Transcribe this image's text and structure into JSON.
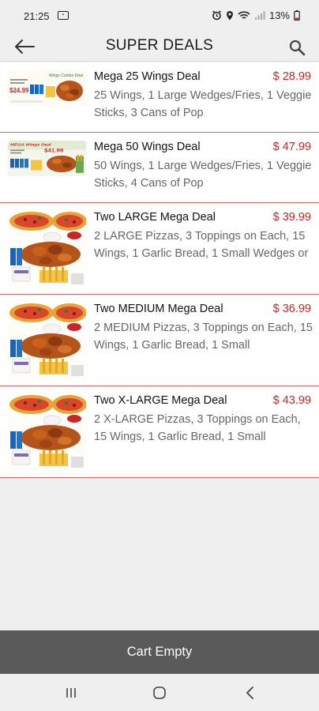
{
  "status_bar": {
    "time": "21:25",
    "battery": "13%"
  },
  "header": {
    "title": "SUPER DEALS"
  },
  "deals": [
    {
      "name": "Mega 25 Wings Deal",
      "price": "$ 28.99",
      "description": "25 Wings, 1 Large Wedges/Fries, 1 Veggie Sticks, 3 Cans of Pop",
      "image_caption": "Wings Combo Deal",
      "image_price": "$24.99"
    },
    {
      "name": "Mega 50 Wings Deal",
      "price": "$ 47.99",
      "description": "50 Wings, 1 Large Wedges/Fries, 1 Veggie Sticks, 4 Cans of Pop",
      "image_caption": "MEGA Wings Deal",
      "image_price": "$41.99"
    },
    {
      "name": "Two LARGE Mega Deal",
      "price": "$ 39.99",
      "description": "2 LARGE Pizzas, 3 Toppings on Each, 15 Wings, 1 Garlic Bread, 1 Small Wedges or"
    },
    {
      "name": "Two MEDIUM Mega Deal",
      "price": "$ 36.99",
      "description": "2 MEDIUM Pizzas, 3 Toppings on Each, 15 Wings, 1 Garlic Bread, 1 Small"
    },
    {
      "name": "Two X-LARGE Mega Deal",
      "price": "$ 43.99",
      "description": "2 X-LARGE Pizzas, 3 Toppings on Each, 15 Wings, 1 Garlic Bread, 1 Small"
    }
  ],
  "cart": {
    "label": "Cart Empty"
  },
  "colors": {
    "price": "#c62828",
    "divider": "#d46a6a",
    "cart_bar": "#5a5a5a"
  }
}
